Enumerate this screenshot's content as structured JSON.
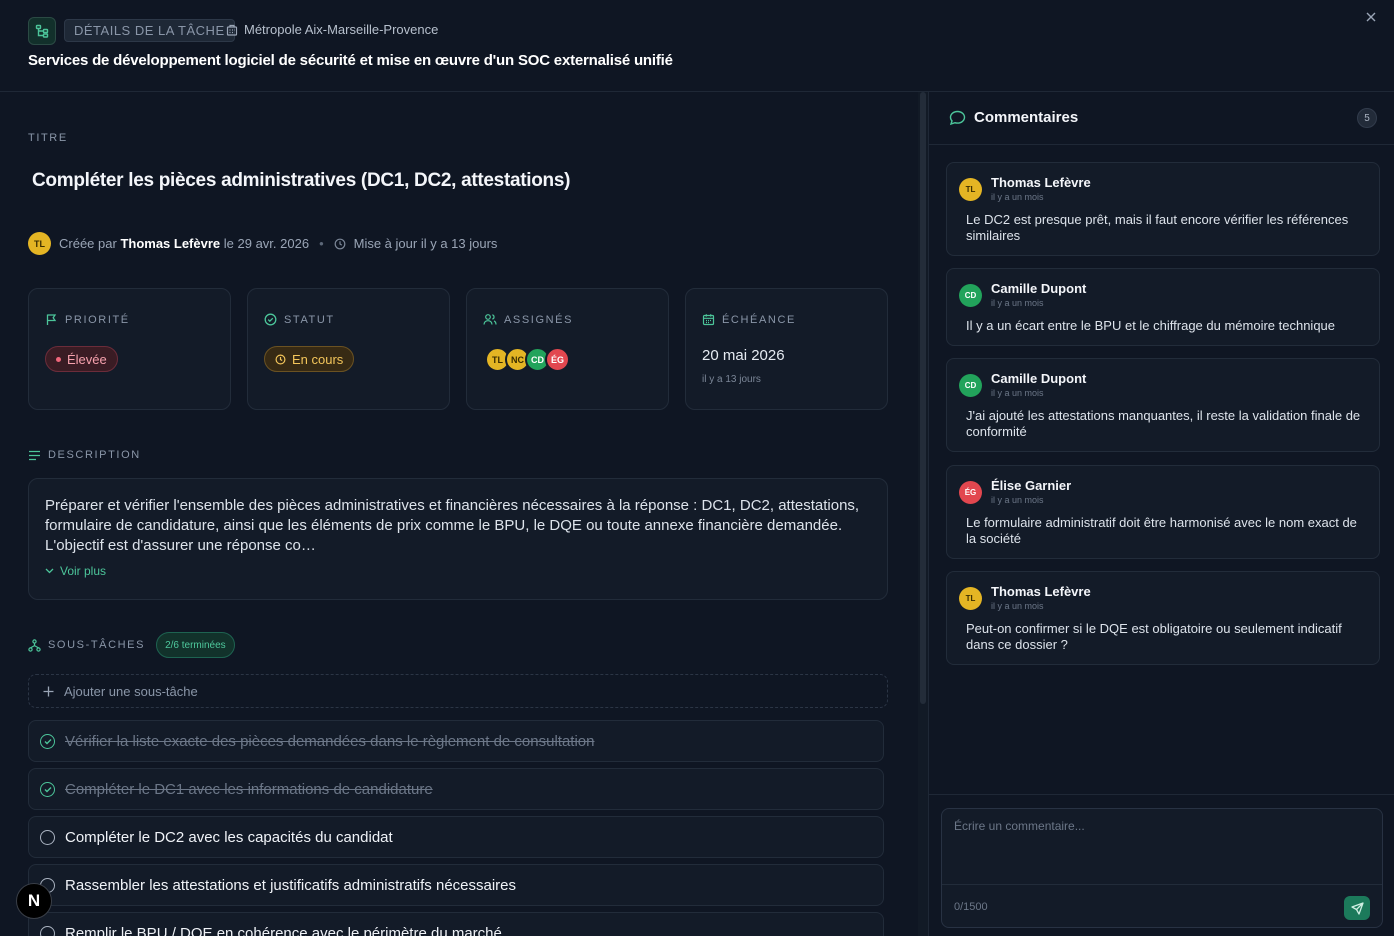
{
  "header": {
    "badge": "DÉTAILS DE LA TÂCHE",
    "organization": "Métropole Aix-Marseille-Provence",
    "title": "Services de développement logiciel de sécurité et mise en œuvre d'un SOC externalisé unifié"
  },
  "task": {
    "section_title_label": "TITRE",
    "title": "Compléter les pièces administratives (DC1, DC2, attestations)",
    "creator_initials": "TL",
    "created_prefix": "Créée par",
    "creator": "Thomas Lefèvre",
    "created_suffix": "le 29 avr. 2026",
    "updated": "Mise à jour il y a 13 jours"
  },
  "cards": {
    "priority": {
      "label": "PRIORITÉ",
      "value": "Élevée"
    },
    "status": {
      "label": "STATUT",
      "value": "En cours"
    },
    "assignees": {
      "label": "ASSIGNÉS",
      "avatars": [
        "TL",
        "NC",
        "CD",
        "ÉG"
      ]
    },
    "due": {
      "label": "ÉCHÉANCE",
      "date": "20 mai 2026",
      "relative": "il y a 13 jours"
    }
  },
  "description": {
    "label": "DESCRIPTION",
    "text": "Préparer et vérifier l'ensemble des pièces administratives et financières nécessaires à la réponse : DC1, DC2, attestations, formulaire de candidature, ainsi que les éléments de prix comme le BPU, le DQE ou toute annexe financière demandée. L'objectif est d'assurer une réponse co…",
    "see_more": "Voir plus"
  },
  "subtasks": {
    "label": "SOUS-TÂCHES",
    "count": "2/6 terminées",
    "add_label": "Ajouter une sous-tâche",
    "items": [
      {
        "text": "Vérifier la liste exacte des pièces demandées dans le règlement de consultation",
        "done": true
      },
      {
        "text": "Compléter le DC1 avec les informations de candidature",
        "done": true
      },
      {
        "text": "Compléter le DC2 avec les capacités du candidat",
        "done": false
      },
      {
        "text": "Rassembler les attestations et justificatifs administratifs nécessaires",
        "done": false
      },
      {
        "text": "Remplir le BPU / DQE en cohérence avec le périmètre du marché",
        "done": false
      }
    ]
  },
  "fab": {
    "label": "N"
  },
  "comments": {
    "title": "Commentaires",
    "count": "5",
    "items": [
      {
        "initials": "TL",
        "author": "Thomas Lefèvre",
        "time": "il y a un mois",
        "text": "Le DC2 est presque prêt, mais il faut encore vérifier les références similaires",
        "color": "#e4b524"
      },
      {
        "initials": "CD",
        "author": "Camille Dupont",
        "time": "il y a un mois",
        "text": "Il y a un écart entre le BPU et le chiffrage du mémoire technique",
        "color": "#22a35b"
      },
      {
        "initials": "CD",
        "author": "Camille Dupont",
        "time": "il y a un mois",
        "text": "J'ai ajouté les attestations manquantes, il reste la validation finale de conformité",
        "color": "#22a35b"
      },
      {
        "initials": "ÉG",
        "author": "Élise Garnier",
        "time": "il y a un mois",
        "text": "Le formulaire administratif doit être harmonisé avec le nom exact de la société",
        "color": "#e2474f"
      },
      {
        "initials": "TL",
        "author": "Thomas Lefèvre",
        "time": "il y a un mois",
        "text": "Peut-on confirmer si le DQE est obligatoire ou seulement indicatif dans ce dossier ?",
        "color": "#e4b524"
      }
    ],
    "composer": {
      "placeholder": "Écrire un commentaire...",
      "char_count": "0/1500"
    }
  }
}
